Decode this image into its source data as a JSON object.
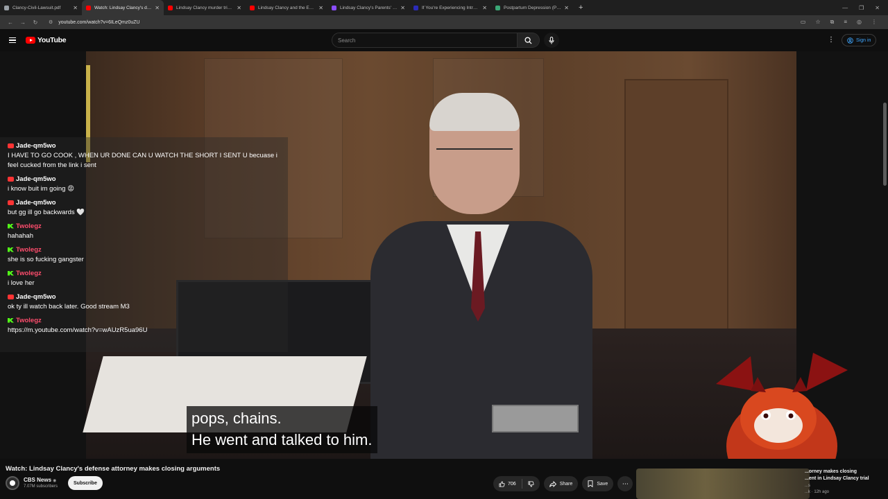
{
  "browser": {
    "tabs": [
      {
        "title": "Clancy-Civil-Lawsuit.pdf",
        "color": "#9aa0a6",
        "active": false
      },
      {
        "title": "Watch: Lindsay Clancy's defense",
        "color": "#ff0000",
        "active": true
      },
      {
        "title": "Lindsay Clancy murder trial: Pr...",
        "color": "#ff0000",
        "active": false
      },
      {
        "title": "Lindsay Clancy and the Eviden...",
        "color": "#ff0000",
        "active": false
      },
      {
        "title": "Lindsay Clancy's Parents' $1 Mi...",
        "color": "#8a4dff",
        "active": false
      },
      {
        "title": "If You're Experiencing Intrusive...",
        "color": "#2b2bb8",
        "active": false
      },
      {
        "title": "Postpartum Depression (PPD)...",
        "color": "#3ba776",
        "active": false
      }
    ],
    "new_tab": "+",
    "url": "youtube.com/watch?v=6ILeQmz0uZU"
  },
  "masthead": {
    "logo_text": "YouTube",
    "search_placeholder": "Search",
    "sign_in": "Sign in"
  },
  "chat": [
    {
      "user": "Jade-qm5wo",
      "platform": "youtube",
      "text": "I HAVE TO GO COOK , WHEN UR DONE CAN U WATCH THE SHORT I SENT U becuase i feel cucked from the link i sent"
    },
    {
      "user": "Jade-qm5wo",
      "platform": "youtube",
      "text": "i know buit im going 😡"
    },
    {
      "user": "Jade-qm5wo",
      "platform": "youtube",
      "text": "but gg ill go backwards 🤍"
    },
    {
      "user": "Twolegz",
      "platform": "kick",
      "text": "hahahah"
    },
    {
      "user": "Twolegz",
      "platform": "kick",
      "text": "she is so fucking gangster"
    },
    {
      "user": "Twolegz",
      "platform": "kick",
      "text": "i love her"
    },
    {
      "user": "Jade-qm5wo",
      "platform": "youtube",
      "text": "ok ty ill watch back later. Good stream M3"
    },
    {
      "user": "Twolegz",
      "platform": "kick",
      "text": "https://m.youtube.com/watch?v=wAUzR5ua96U"
    }
  ],
  "captions": {
    "line1": "pops, chains.",
    "line2": "He went and talked to him."
  },
  "video": {
    "title": "Watch: Lindsay Clancy's defense attorney makes closing arguments",
    "channel": "CBS News",
    "verified": "◉",
    "subscribers": "7.07M subscribers",
    "subscribe": "Subscribe",
    "likes": "706",
    "share": "Share",
    "save": "Save"
  },
  "recommended": {
    "title_line1": "...orney makes closing",
    "title_line2": "...ent in Lindsay Clancy trial",
    "channel": "...s",
    "age": "...k · 12h ago"
  }
}
